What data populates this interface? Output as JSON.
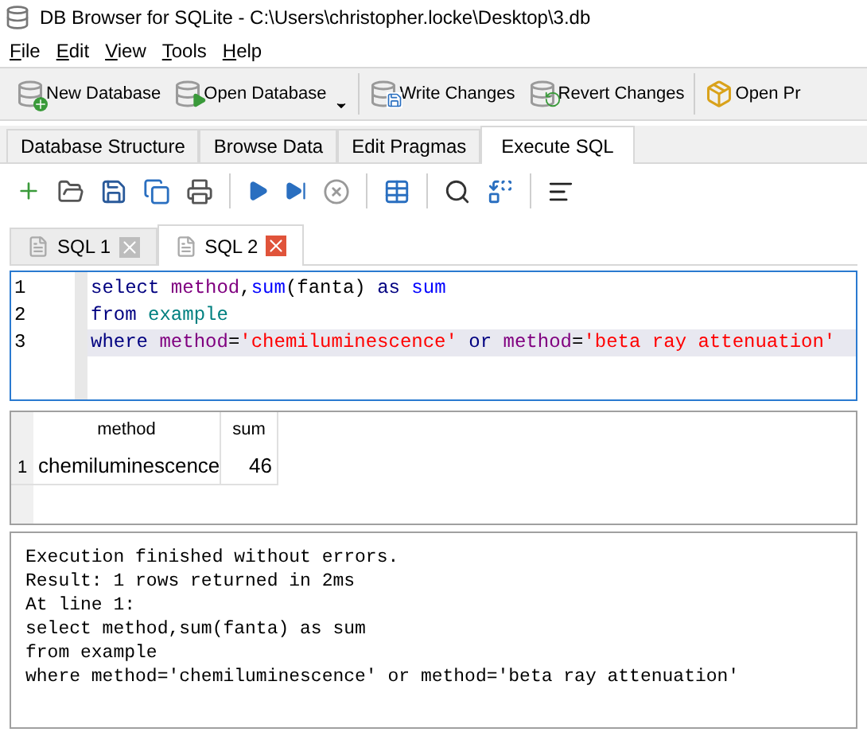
{
  "window": {
    "title": "DB Browser for SQLite - C:\\Users\\christopher.locke\\Desktop\\3.db"
  },
  "menu": [
    {
      "label": "File"
    },
    {
      "label": "Edit"
    },
    {
      "label": "View"
    },
    {
      "label": "Tools"
    },
    {
      "label": "Help"
    }
  ],
  "toolbar": [
    {
      "label": "New Database",
      "kind": "new"
    },
    {
      "label": "Open Database",
      "kind": "open",
      "dropdown": true
    },
    {
      "label": "Write Changes",
      "kind": "write"
    },
    {
      "label": "Revert Changes",
      "kind": "revert"
    },
    {
      "label": "Open Pr",
      "kind": "project"
    }
  ],
  "tabs": [
    {
      "label": "Database Structure",
      "selected": false
    },
    {
      "label": "Browse Data",
      "selected": false
    },
    {
      "label": "Edit Pragmas",
      "selected": false
    },
    {
      "label": "Execute SQL",
      "selected": true
    }
  ],
  "sql_tabs": [
    {
      "label": "SQL 1",
      "selected": false
    },
    {
      "label": "SQL 2",
      "selected": true
    }
  ],
  "editor": {
    "lines": [
      {
        "number": "1",
        "current": false,
        "tokens": [
          {
            "text": "select ",
            "kind": "keyword"
          },
          {
            "text": "method",
            "kind": "column"
          },
          {
            "text": ",",
            "kind": "plain"
          },
          {
            "text": "sum",
            "kind": "function"
          },
          {
            "text": "(fanta) ",
            "kind": "plain"
          },
          {
            "text": "as ",
            "kind": "keyword"
          },
          {
            "text": "sum",
            "kind": "function"
          }
        ]
      },
      {
        "number": "2",
        "current": false,
        "tokens": [
          {
            "text": "from ",
            "kind": "keyword"
          },
          {
            "text": "example",
            "kind": "table"
          }
        ]
      },
      {
        "number": "3",
        "current": true,
        "tokens": [
          {
            "text": "where ",
            "kind": "keyword"
          },
          {
            "text": "method",
            "kind": "column"
          },
          {
            "text": "=",
            "kind": "plain"
          },
          {
            "text": "'chemiluminescence'",
            "kind": "string"
          },
          {
            "text": " or ",
            "kind": "keyword"
          },
          {
            "text": "method",
            "kind": "column"
          },
          {
            "text": "=",
            "kind": "plain"
          },
          {
            "text": "'beta ray attenuation'",
            "kind": "string"
          }
        ]
      }
    ]
  },
  "results": {
    "columns": [
      "method",
      "sum"
    ],
    "rows": [
      {
        "number": "1",
        "cells": [
          "chemiluminescence",
          "46"
        ]
      }
    ]
  },
  "messages": [
    "Execution finished without errors.",
    "Result: 1 rows returned in 2ms",
    "At line 1:",
    "select method,sum(fanta) as sum",
    "from example",
    "where method='chemiluminescence' or method='beta ray attenuation'"
  ]
}
